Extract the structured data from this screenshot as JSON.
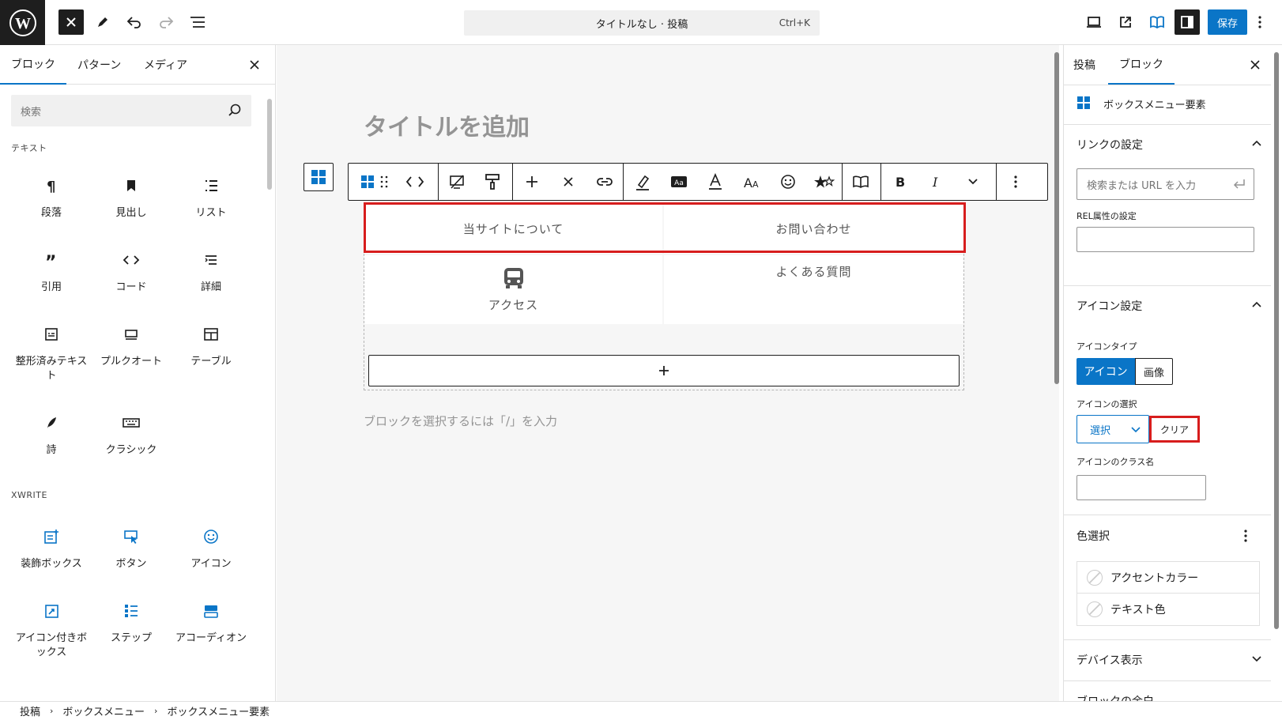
{
  "topbar": {
    "document_title": "タイトルなし · 投稿",
    "shortcut": "Ctrl+K",
    "save_label": "保存"
  },
  "inserter": {
    "tabs": [
      "ブロック",
      "パターン",
      "メディア"
    ],
    "search_placeholder": "検索",
    "categories": [
      {
        "label": "テキスト",
        "items": [
          "段落",
          "見出し",
          "リスト",
          "引用",
          "コード",
          "詳細",
          "整形済みテキスト",
          "プルクオート",
          "テーブル",
          "詩",
          "クラシック"
        ]
      },
      {
        "label": "XWRITE",
        "items": [
          "装飾ボックス",
          "ボタン",
          "アイコン",
          "アイコン付きボックス",
          "ステップ",
          "アコーディオン"
        ]
      }
    ]
  },
  "editor": {
    "title_placeholder": "タイトルを追加",
    "menu_items": [
      "当サイトについて",
      "お問い合わせ",
      "アクセス",
      "よくある質問"
    ],
    "append_hint": "ブロックを選択するには「/」を入力"
  },
  "sidebar": {
    "tabs": [
      "投稿",
      "ブロック"
    ],
    "block_name": "ボックスメニュー要素",
    "link_section": "リンクの設定",
    "link_placeholder": "検索または URL を入力",
    "rel_label": "REL属性の設定",
    "icon_section": "アイコン設定",
    "icon_type_label": "アイコンタイプ",
    "icon_type_options": [
      "アイコン",
      "画像"
    ],
    "icon_select_label": "アイコンの選択",
    "select_label": "選択",
    "clear_label": "クリア",
    "class_label": "アイコンのクラス名",
    "color_section": "色選択",
    "colors": [
      "アクセントカラー",
      "テキスト色"
    ],
    "device_section": "デバイス表示",
    "next_section": "ブロックの余白"
  },
  "breadcrumb": [
    "投稿",
    "ボックスメニュー",
    "ボックスメニュー要素"
  ],
  "colors": {
    "accent": "#0a75c7",
    "highlight": "#d71d1d"
  }
}
